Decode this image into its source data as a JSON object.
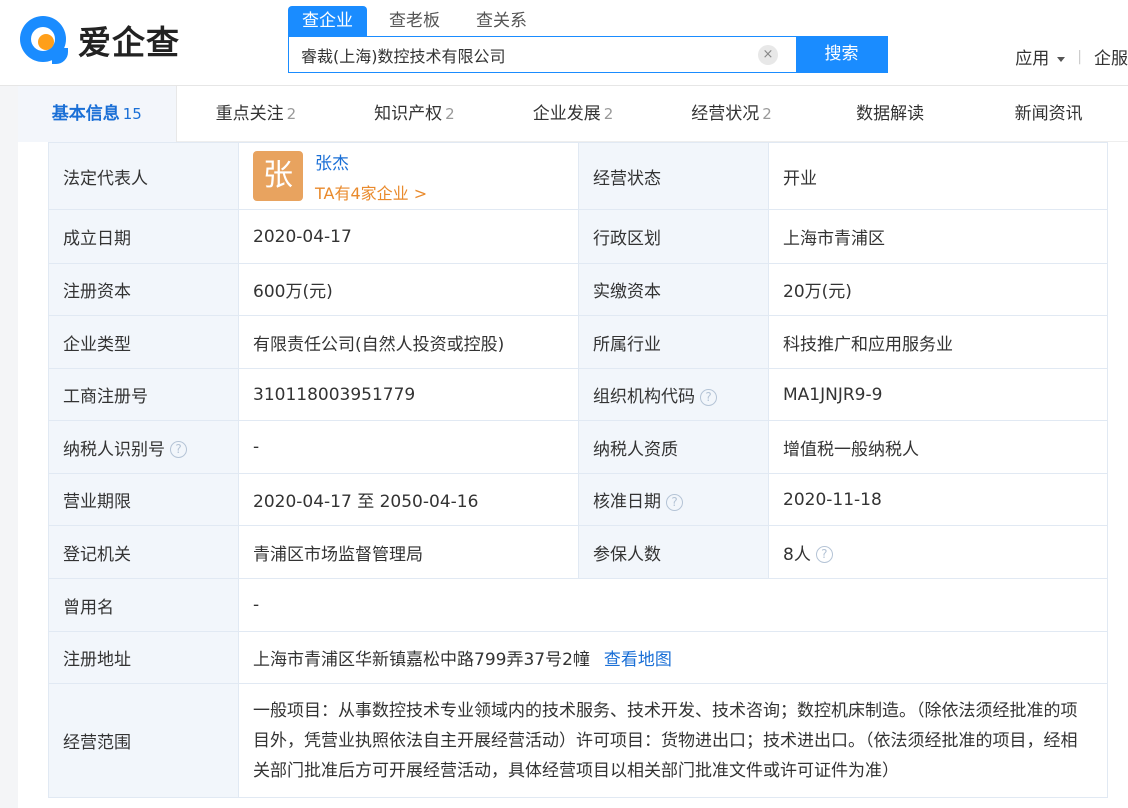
{
  "logo": {
    "text": "爱企查"
  },
  "search": {
    "tabs": [
      "查企业",
      "查老板",
      "查关系"
    ],
    "value": "睿裁(上海)数控技术有限公司",
    "clear_icon": "×",
    "button": "搜索"
  },
  "topnav": {
    "app_label": "应用",
    "service_label": "企服"
  },
  "tabs": [
    {
      "label": "基本信息",
      "count": "15"
    },
    {
      "label": "重点关注",
      "count": "2"
    },
    {
      "label": "知识产权",
      "count": "2"
    },
    {
      "label": "企业发展",
      "count": "2"
    },
    {
      "label": "经营状况",
      "count": "2"
    },
    {
      "label": "数据解读",
      "count": ""
    },
    {
      "label": "新闻资讯",
      "count": ""
    }
  ],
  "info": {
    "legal_rep_label": "法定代表人",
    "legal_rep_avatar": "张",
    "legal_rep_name": "张杰",
    "legal_rep_link": "TA有4家企业 >",
    "status_label": "经营状态",
    "status_value": "开业",
    "founded_label": "成立日期",
    "founded_value": "2020-04-17",
    "region_label": "行政区划",
    "region_value": "上海市青浦区",
    "reg_capital_label": "注册资本",
    "reg_capital_value": "600万(元)",
    "paid_capital_label": "实缴资本",
    "paid_capital_value": "20万(元)",
    "type_label": "企业类型",
    "type_value": "有限责任公司(自然人投资或控股)",
    "industry_label": "所属行业",
    "industry_value": "科技推广和应用服务业",
    "reg_no_label": "工商注册号",
    "reg_no_value": "310118003951779",
    "org_code_label": "组织机构代码",
    "org_code_value": "MA1JNJR9-9",
    "taxpayer_id_label": "纳税人识别号",
    "taxpayer_id_value": "-",
    "taxpayer_qual_label": "纳税人资质",
    "taxpayer_qual_value": "增值税一般纳税人",
    "term_label": "营业期限",
    "term_value": "2020-04-17 至 2050-04-16",
    "approval_label": "核准日期",
    "approval_value": "2020-11-18",
    "authority_label": "登记机关",
    "authority_value": "青浦区市场监督管理局",
    "insured_label": "参保人数",
    "insured_value": "8人",
    "former_name_label": "曾用名",
    "former_name_value": "-",
    "address_label": "注册地址",
    "address_value": "上海市青浦区华新镇嘉松中路799弄37号2幢",
    "map_link": "查看地图",
    "scope_label": "经营范围",
    "scope_value": "一般项目：从事数控技术专业领域内的技术服务、技术开发、技术咨询；数控机床制造。（除依法须经批准的项目外，凭营业执照依法自主开展经营活动）许可项目：货物进出口；技术进出口。（依法须经批准的项目，经相关部门批准后方可开展经营活动，具体经营项目以相关部门批准文件或许可证件为准）"
  },
  "help_icon": "?"
}
